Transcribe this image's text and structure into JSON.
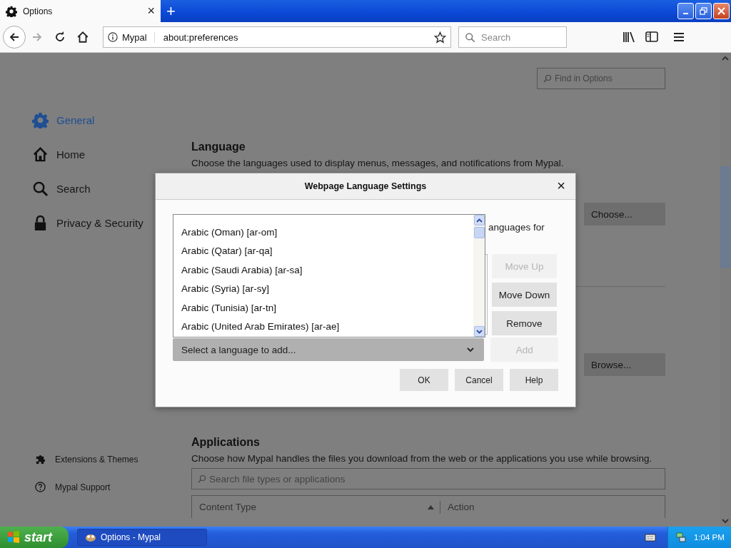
{
  "browser": {
    "tab": {
      "title": "Options",
      "close": "×",
      "new_tab": "+"
    },
    "address": {
      "site": "Mypal",
      "url": "about:preferences"
    },
    "search": {
      "placeholder": "Search"
    }
  },
  "sidebar": {
    "items": [
      {
        "label": "General",
        "kind": "gear",
        "selected": true
      },
      {
        "label": "Home",
        "kind": "home",
        "selected": false
      },
      {
        "label": "Search",
        "kind": "search",
        "selected": false
      },
      {
        "label": "Privacy & Security",
        "kind": "lock",
        "selected": false
      }
    ],
    "footer": [
      {
        "label": "Extensions & Themes",
        "kind": "puzzle"
      },
      {
        "label": "Mypal Support",
        "kind": "help"
      }
    ]
  },
  "find": {
    "placeholder": "Find in Options"
  },
  "language": {
    "heading": "Language",
    "description": "Choose the languages used to display menus, messages, and notifications from Mypal.",
    "choose_button": "Choose...",
    "browse_button": "Browse..."
  },
  "applications": {
    "heading": "Applications",
    "description": "Choose how Mypal handles the files you download from the web or the applications you use while browsing.",
    "search_placeholder": "Search file types or applications",
    "columns": [
      "Content Type",
      "Action"
    ]
  },
  "dialog": {
    "title": "Webpage Language Settings",
    "close": "×",
    "description_fragment": "anguages for",
    "options": [
      "Arabic (Oman) [ar-om]",
      "Arabic (Qatar) [ar-qa]",
      "Arabic (Saudi Arabia) [ar-sa]",
      "Arabic (Syria) [ar-sy]",
      "Arabic (Tunisia) [ar-tn]",
      "Arabic (United Arab Emirates) [ar-ae]"
    ],
    "select_placeholder": "Select a language to add...",
    "side_buttons": [
      {
        "label": "Move Up",
        "disabled": true
      },
      {
        "label": "Move Down",
        "disabled": false
      },
      {
        "label": "Remove",
        "disabled": false
      },
      {
        "label": "Add",
        "disabled": true
      }
    ],
    "buttons": [
      "OK",
      "Cancel",
      "Help"
    ]
  },
  "taskbar": {
    "start": "start",
    "task": "Options - Mypal",
    "clock": "1:04 PM"
  }
}
